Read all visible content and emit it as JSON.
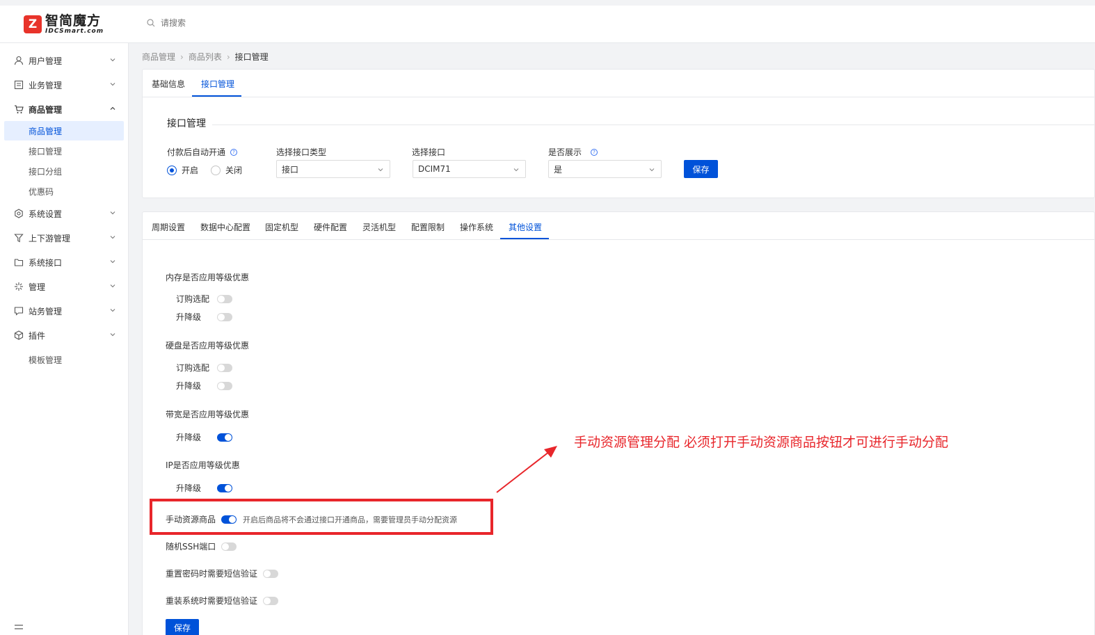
{
  "brand": {
    "logo_mark": "Z",
    "name_cn": "智简魔方",
    "name_en": "IDCSmart.com"
  },
  "search": {
    "placeholder": "请搜索"
  },
  "sidebar": {
    "items": [
      {
        "label": "用户管理",
        "icon": "user-icon"
      },
      {
        "label": "业务管理",
        "icon": "list-icon"
      },
      {
        "label": "商品管理",
        "icon": "cart-icon",
        "expanded": true
      },
      {
        "label": "系统设置",
        "icon": "gear-icon"
      },
      {
        "label": "上下游管理",
        "icon": "filter-icon"
      },
      {
        "label": "系统接口",
        "icon": "folder-icon"
      },
      {
        "label": "管理",
        "icon": "sparkle-icon"
      },
      {
        "label": "站务管理",
        "icon": "chat-icon"
      },
      {
        "label": "插件",
        "icon": "cube-icon"
      }
    ],
    "sub_items": [
      "商品管理",
      "接口管理",
      "接口分组",
      "优惠码"
    ],
    "extra": "模板管理"
  },
  "breadcrumb": [
    "商品管理",
    "商品列表",
    "接口管理"
  ],
  "top_tabs": [
    "基础信息",
    "接口管理"
  ],
  "interface": {
    "title": "接口管理",
    "auto_open_label": "付款后自动开通",
    "radio_on": "开启",
    "radio_off": "关闭",
    "type_label": "选择接口类型",
    "type_value": "接口",
    "iface_label": "选择接口",
    "iface_value": "DCIM71",
    "show_label": "是否展示",
    "show_value": "是",
    "save": "保存"
  },
  "config_tabs": [
    "周期设置",
    "数据中心配置",
    "固定机型",
    "硬件配置",
    "灵活机型",
    "配置限制",
    "操作系统",
    "其他设置"
  ],
  "other": {
    "mem_label": "内存是否应用等级优惠",
    "disk_label": "硬盘是否应用等级优惠",
    "bw_label": "带宽是否应用等级优惠",
    "ip_label": "IP是否应用等级优惠",
    "order_opt": "订购选配",
    "upgrade": "升降级",
    "manual_label": "手动资源商品",
    "manual_hint": "开启后商品将不会通过接口开通商品，需要管理员手动分配资源",
    "ssh_label": "随机SSH端口",
    "reset_pw_label": "重置密码时需要短信验证",
    "reinstall_label": "重装系统时需要短信验证",
    "save": "保存"
  },
  "switches": {
    "mem_order": false,
    "mem_upgrade": false,
    "disk_order": false,
    "disk_upgrade": false,
    "bw_upgrade": true,
    "ip_upgrade": true,
    "manual": true,
    "ssh": false,
    "reset_pw": false,
    "reinstall": false
  },
  "annotation": "手动资源管理分配 必须打开手动资源商品按钮才可进行手动分配",
  "colors": {
    "primary": "#0052d9",
    "annotation": "#e8262b"
  }
}
